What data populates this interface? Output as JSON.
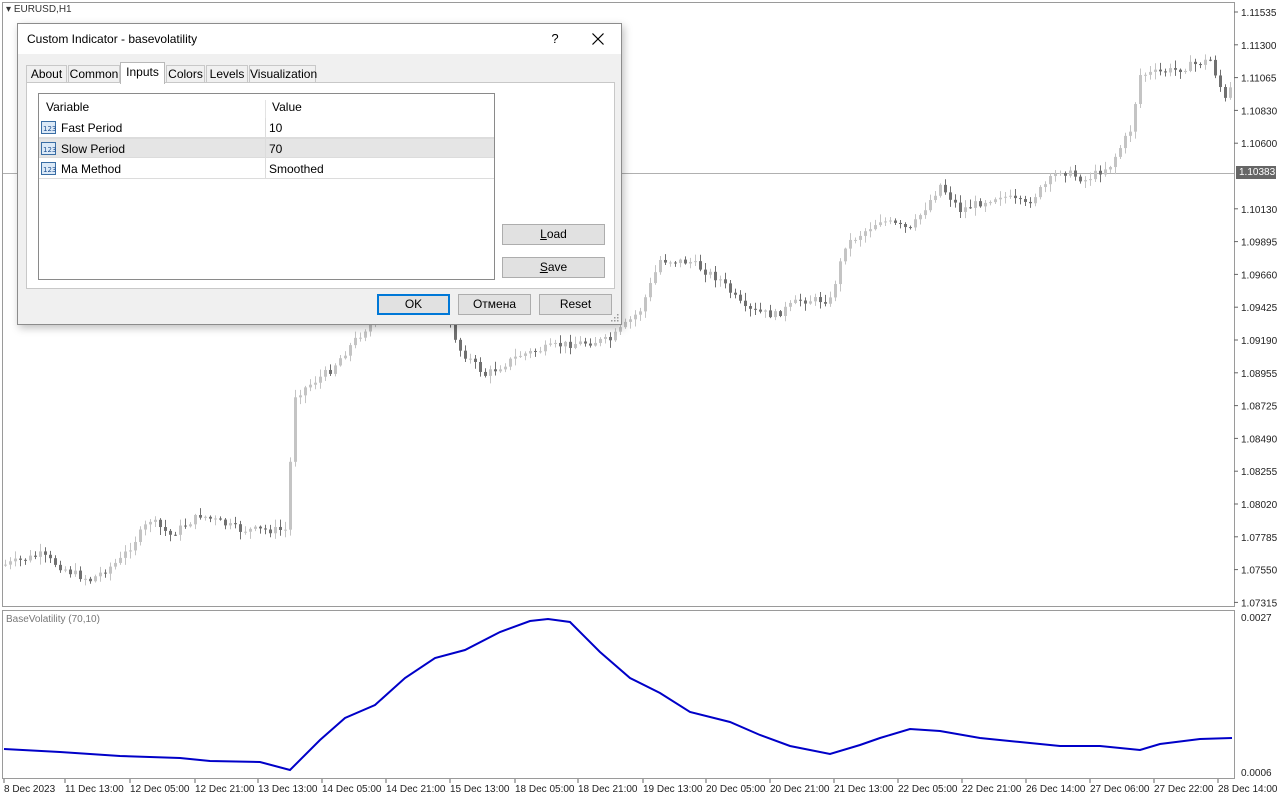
{
  "chart": {
    "symbol_label": "EURUSD,H1",
    "current_price_label": "1.10383",
    "price_axis_labels": [
      "1.11535",
      "1.11300",
      "1.11065",
      "1.10830",
      "1.10600",
      "1.10383",
      "1.10130",
      "1.09895",
      "1.09660",
      "1.09425",
      "1.09190",
      "1.08955",
      "1.08725",
      "1.08490",
      "1.08255",
      "1.08020",
      "1.07785",
      "1.07550",
      "1.07315"
    ],
    "indicator_label": "BaseVolatility (70,10)",
    "indicator_axis_labels": [
      "0.0027",
      "0.0006"
    ],
    "time_axis_labels": [
      "8 Dec 2023",
      "11 Dec 13:00",
      "12 Dec 05:00",
      "12 Dec 21:00",
      "13 Dec 13:00",
      "14 Dec 05:00",
      "14 Dec 21:00",
      "15 Dec 13:00",
      "18 Dec 05:00",
      "18 Dec 21:00",
      "19 Dec 13:00",
      "20 Dec 05:00",
      "20 Dec 21:00",
      "21 Dec 13:00",
      "22 Dec 05:00",
      "22 Dec 21:00",
      "26 Dec 14:00",
      "27 Dec 06:00",
      "27 Dec 22:00",
      "28 Dec 14:00"
    ],
    "colors": {
      "bull": "#c4c4c4",
      "bear": "#707070",
      "indicator_line": "#0000c8"
    }
  },
  "dialog": {
    "title": "Custom Indicator - basevolatility",
    "help_label": "?",
    "close_icon": "close-icon",
    "tabs": [
      {
        "label": "About"
      },
      {
        "label": "Common"
      },
      {
        "label": "Inputs"
      },
      {
        "label": "Colors"
      },
      {
        "label": "Levels"
      },
      {
        "label": "Visualization"
      }
    ],
    "active_tab": "Inputs",
    "table": {
      "headers": {
        "variable": "Variable",
        "value": "Value"
      },
      "rows": [
        {
          "variable": "Fast Period",
          "value": "10",
          "icon": "numeric-param-icon"
        },
        {
          "variable": "Slow Period",
          "value": "70",
          "icon": "numeric-param-icon"
        },
        {
          "variable": "Ma Method",
          "value": "Smoothed",
          "icon": "numeric-param-icon"
        }
      ]
    },
    "side_buttons": {
      "load": {
        "first": "L",
        "rest": "oad"
      },
      "save": {
        "first": "S",
        "rest": "ave"
      }
    },
    "buttons": {
      "ok": "OK",
      "cancel": "Отмена",
      "reset": "Reset"
    }
  }
}
